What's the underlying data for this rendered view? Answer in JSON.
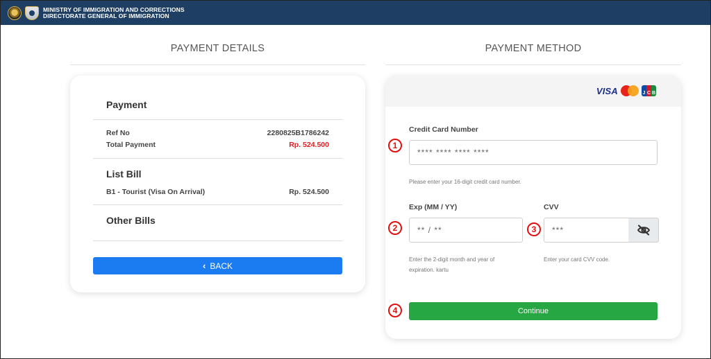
{
  "header": {
    "line1": "MINISTRY OF IMMIGRATION AND CORRECTIONS",
    "line2": "DIRECTORATE GENERAL OF IMMIGRATION"
  },
  "details": {
    "section_title": "PAYMENT DETAILS",
    "payment_heading": "Payment",
    "ref_label": "Ref No",
    "ref_value": "2280825B1786242",
    "total_label": "Total Payment",
    "total_value": "Rp. 524.500",
    "list_bill_heading": "List Bill",
    "bill_item_label": "B1 - Tourist (Visa On Arrival)",
    "bill_item_value": "Rp. 524.500",
    "other_bills_heading": "Other Bills",
    "back_label": "BACK"
  },
  "method": {
    "section_title": "PAYMENT METHOD",
    "brands": {
      "visa": "VISA",
      "jcb": [
        "J",
        "C",
        "B"
      ]
    },
    "card_number_label": "Credit Card Number",
    "card_number_placeholder": "**** **** **** ****",
    "card_number_help": "Please enter your 16-digit credit card number.",
    "exp_label": "Exp (MM / YY)",
    "exp_placeholder": "** / **",
    "exp_help": "Enter the 2-digit month and year of expiration. kartu",
    "cvv_label": "CVV",
    "cvv_placeholder": "***",
    "cvv_help": "Enter your card CVV code.",
    "continue_label": "Continue"
  },
  "markers": [
    "1",
    "2",
    "3",
    "4"
  ],
  "colors": {
    "header_bg": "#1f3e63",
    "back_button": "#1a7cf0",
    "continue_button": "#26a743",
    "total_red": "#e3191f",
    "marker_red": "#e20f0f"
  },
  "icons": {
    "back": "chevron-left-icon",
    "cvv_toggle": "eye-slash-icon"
  }
}
